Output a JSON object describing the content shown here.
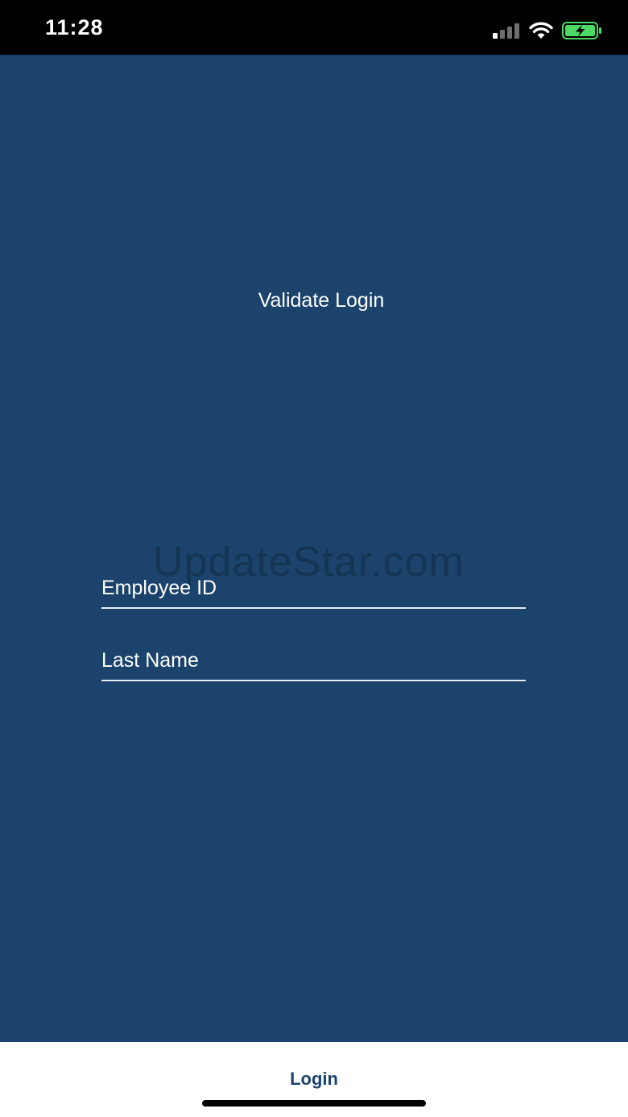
{
  "status_bar": {
    "time": "11:28",
    "icons": [
      "signal-icon",
      "wifi-icon",
      "battery-charging-icon"
    ],
    "battery_color": "#4cd964"
  },
  "main": {
    "title": "Validate Login",
    "watermark": "UpdateStar.com",
    "fields": {
      "employee_id": {
        "placeholder": "Employee ID",
        "value": ""
      },
      "last_name": {
        "placeholder": "Last Name",
        "value": ""
      }
    }
  },
  "footer": {
    "login_label": "Login"
  },
  "colors": {
    "background": "#1b436b",
    "accent": "#1b436b",
    "text": "#ffffff"
  }
}
